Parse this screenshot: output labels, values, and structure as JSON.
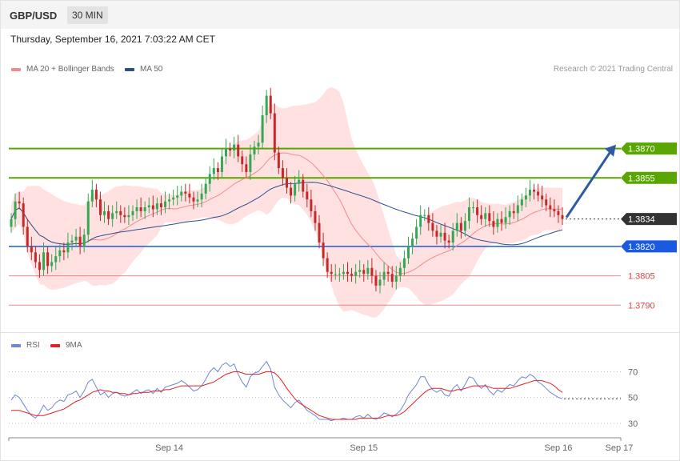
{
  "header": {
    "symbol": "GBP/USD",
    "timeframe": "30 MIN"
  },
  "datetime": "Thursday, September 16, 2021 7:03:22 AM CET",
  "legend": {
    "ma20_label": "MA 20 + Bollinger Bands",
    "ma20_color": "#f28b8b",
    "ma50_label": "MA 50",
    "ma50_color": "#2a4f8f"
  },
  "credit": "Research © 2021 Trading Central",
  "rsi_legend": {
    "rsi_label": "RSI",
    "rsi_color": "#6e86d6",
    "ma_label": "9MA",
    "ma_color": "#e02020"
  },
  "chart_data": [
    {
      "type": "candlestick",
      "ylim": [
        1.3775,
        1.3905
      ],
      "x_ticks": [
        {
          "label": "Sep 14",
          "index": 39
        },
        {
          "label": "Sep 15",
          "index": 87
        },
        {
          "label": "Sep 16",
          "index": 135
        },
        {
          "label": "Sep 17",
          "index": 150
        }
      ],
      "levels": [
        {
          "value": 1.387,
          "label": "1.3870",
          "kind": "resistance",
          "color": "#5aa600"
        },
        {
          "value": 1.3855,
          "label": "1.3855",
          "kind": "resistance",
          "color": "#5aa600"
        },
        {
          "value": 1.3834,
          "label": "1.3834",
          "kind": "last",
          "color": "#333333"
        },
        {
          "value": 1.382,
          "label": "1.3820",
          "kind": "pivot",
          "color": "#1a5ae0"
        },
        {
          "value": 1.3805,
          "label": "1.3805",
          "kind": "support",
          "color": "#e04545"
        },
        {
          "value": 1.379,
          "label": "1.3790",
          "kind": "support",
          "color": "#e04545"
        }
      ],
      "up_color": "#34a853",
      "down_color": "#c62828",
      "band_color": "#ffdcdc",
      "arrow_target": 1.3872,
      "closes": [
        1.3834,
        1.3843,
        1.3842,
        1.383,
        1.382,
        1.3817,
        1.3812,
        1.3808,
        1.3817,
        1.381,
        1.3812,
        1.3815,
        1.3818,
        1.3817,
        1.3822,
        1.3823,
        1.3825,
        1.382,
        1.3826,
        1.3843,
        1.3849,
        1.3844,
        1.3836,
        1.3838,
        1.3834,
        1.3837,
        1.3838,
        1.3836,
        1.3835,
        1.3836,
        1.3838,
        1.384,
        1.3838,
        1.384,
        1.3841,
        1.3839,
        1.3842,
        1.384,
        1.3843,
        1.3844,
        1.3845,
        1.3846,
        1.3848,
        1.3847,
        1.3845,
        1.3843,
        1.3844,
        1.3847,
        1.3852,
        1.3857,
        1.386,
        1.3858,
        1.3866,
        1.387,
        1.3869,
        1.3872,
        1.3866,
        1.3862,
        1.3858,
        1.3867,
        1.3871,
        1.3873,
        1.3887,
        1.3897,
        1.3888,
        1.3868,
        1.386,
        1.3855,
        1.385,
        1.3846,
        1.3852,
        1.3854,
        1.3848,
        1.3844,
        1.3838,
        1.3832,
        1.3822,
        1.3814,
        1.3807,
        1.3806,
        1.3806,
        1.3806,
        1.3807,
        1.3806,
        1.3805,
        1.3807,
        1.3808,
        1.3806,
        1.3809,
        1.3805,
        1.38,
        1.3803,
        1.3807,
        1.3806,
        1.3802,
        1.3805,
        1.3809,
        1.3814,
        1.382,
        1.3824,
        1.383,
        1.3836,
        1.3836,
        1.3832,
        1.3828,
        1.3825,
        1.3827,
        1.3823,
        1.3822,
        1.3828,
        1.3832,
        1.3828,
        1.3833,
        1.384,
        1.384,
        1.3836,
        1.3834,
        1.3837,
        1.3833,
        1.383,
        1.3834,
        1.3832,
        1.3835,
        1.3838,
        1.3837,
        1.3841,
        1.3844,
        1.3846,
        1.3849,
        1.3848,
        1.3846,
        1.3844,
        1.3841,
        1.3839,
        1.3838,
        1.3836,
        1.3834
      ]
    },
    {
      "type": "line",
      "title": "RSI",
      "ylim": [
        20,
        82
      ],
      "y_ticks": [
        30,
        50,
        70
      ],
      "series": [
        {
          "name": "RSI",
          "values": [
            48,
            52,
            50,
            45,
            40,
            36,
            34,
            38,
            44,
            40,
            42,
            46,
            48,
            47,
            52,
            53,
            55,
            50,
            55,
            62,
            64,
            58,
            52,
            54,
            50,
            53,
            54,
            52,
            51,
            52,
            54,
            56,
            53,
            55,
            56,
            53,
            57,
            54,
            58,
            59,
            60,
            61,
            63,
            61,
            58,
            55,
            56,
            59,
            64,
            70,
            73,
            70,
            75,
            77,
            74,
            76,
            68,
            62,
            58,
            66,
            69,
            70,
            74,
            78,
            72,
            58,
            52,
            48,
            45,
            42,
            46,
            48,
            44,
            40,
            38,
            36,
            33,
            33,
            33,
            32,
            33,
            33,
            34,
            33,
            33,
            35,
            36,
            34,
            37,
            34,
            33,
            35,
            38,
            37,
            35,
            37,
            40,
            45,
            52,
            56,
            60,
            66,
            66,
            60,
            56,
            54,
            56,
            52,
            51,
            57,
            60,
            55,
            60,
            66,
            65,
            60,
            57,
            60,
            55,
            52,
            56,
            54,
            57,
            60,
            59,
            63,
            66,
            65,
            68,
            66,
            62,
            60,
            57,
            54,
            52,
            50,
            49
          ]
        },
        {
          "name": "9MA",
          "values": [
            40,
            40,
            40,
            39,
            38,
            37,
            36,
            36,
            36,
            37,
            38,
            39,
            40,
            41,
            43,
            45,
            47,
            48,
            50,
            52,
            54,
            55,
            56,
            55,
            55,
            54,
            54,
            53,
            53,
            52,
            53,
            53,
            54,
            54,
            54,
            55,
            55,
            55,
            56,
            56,
            57,
            58,
            59,
            59,
            59,
            59,
            59,
            59,
            60,
            61,
            62,
            64,
            66,
            68,
            69,
            70,
            70,
            69,
            68,
            68,
            68,
            68,
            69,
            70,
            70,
            69,
            66,
            62,
            57,
            53,
            49,
            46,
            44,
            42,
            40,
            38,
            36,
            35,
            34,
            33,
            33,
            33,
            33,
            33,
            33,
            33,
            34,
            34,
            34,
            34,
            34,
            34,
            35,
            36,
            36,
            36,
            37,
            39,
            42,
            45,
            48,
            51,
            54,
            56,
            57,
            57,
            57,
            56,
            55,
            55,
            56,
            56,
            57,
            58,
            59,
            59,
            59,
            59,
            58,
            57,
            57,
            57,
            57,
            57,
            58,
            59,
            60,
            61,
            62,
            63,
            63,
            63,
            62,
            61,
            59,
            56,
            54
          ]
        }
      ]
    }
  ]
}
